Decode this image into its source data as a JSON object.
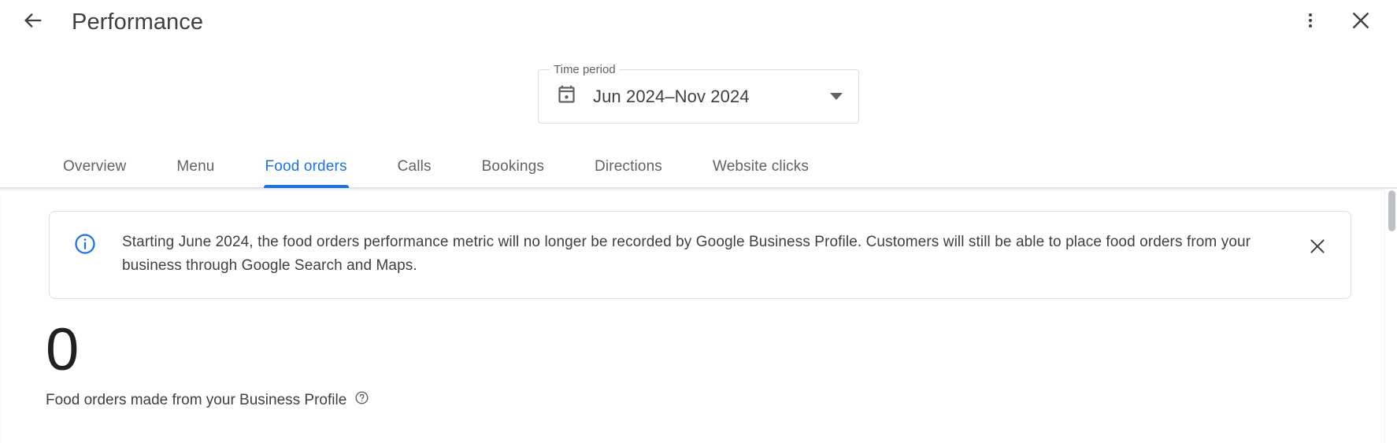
{
  "header": {
    "title": "Performance",
    "back_icon": "arrow-back-icon",
    "overflow_icon": "more-vert-icon",
    "close_icon": "close-icon"
  },
  "time_period": {
    "legend": "Time period",
    "value": "Jun 2024–Nov 2024",
    "calendar_icon": "calendar-icon",
    "caret_icon": "chevron-down-icon"
  },
  "tabs": [
    {
      "label": "Overview",
      "active": false
    },
    {
      "label": "Menu",
      "active": false
    },
    {
      "label": "Food orders",
      "active": true
    },
    {
      "label": "Calls",
      "active": false
    },
    {
      "label": "Bookings",
      "active": false
    },
    {
      "label": "Directions",
      "active": false
    },
    {
      "label": "Website clicks",
      "active": false
    }
  ],
  "banner": {
    "icon": "info-icon",
    "text": "Starting June 2024, the food orders performance metric will no longer be recorded by Google Business Profile. Customers will still be able to place food orders from your business through Google Search and Maps.",
    "close_icon": "close-icon"
  },
  "metric": {
    "value": "0",
    "caption": "Food orders made from your Business Profile",
    "help_icon": "help-outline-icon"
  },
  "colors": {
    "accent": "#1a73e8",
    "text_primary": "#3c4043",
    "text_secondary": "#5f6368",
    "border": "#dadce0"
  }
}
